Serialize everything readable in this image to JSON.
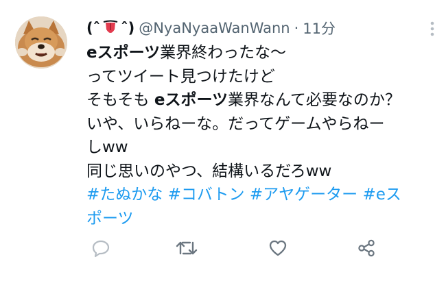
{
  "author": {
    "name_left": "(ˆ",
    "name_right": "ˆ)",
    "handle": "@NyaNyaaWanWann",
    "separator": "·",
    "time": "11分"
  },
  "tweet": {
    "line1_bold": "eスポーツ",
    "line1_rest": "業界終わったな〜",
    "line2": "ってツイート見つけたけど",
    "line3_pre": "そもそも ",
    "line3_bold": "eスポーツ",
    "line3_post": "業界なんて必要なのか？",
    "line4": "いや、いらねーな。だってゲームやらねー",
    "line5": "しww",
    "line6": "同じ思いのやつ、結構いるだろww",
    "hashtags": [
      "#たぬかな",
      "#コバトン",
      "#アヤゲーター",
      "#eス"
    ],
    "hashtag_cont": "ポーツ"
  },
  "icons": {
    "more": "more-vertical-icon",
    "reply": "reply-icon",
    "retweet": "retweet-icon",
    "like": "heart-icon",
    "share": "share-icon"
  },
  "colors": {
    "text": "#0f1419",
    "secondary": "#536471",
    "link": "#1d9bf0",
    "icon_gray": "#b5bcc3"
  }
}
